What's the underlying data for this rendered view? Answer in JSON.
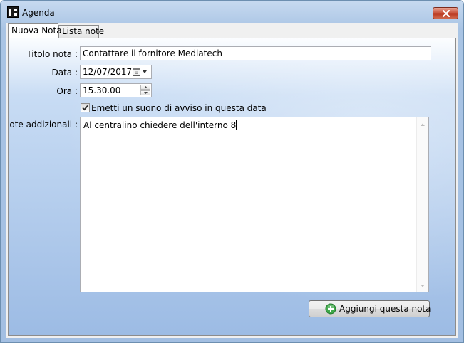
{
  "window": {
    "title": "Agenda",
    "close_icon": "close-icon"
  },
  "tabs": [
    {
      "label": "Nuova Nota",
      "active": true
    },
    {
      "label": "Lista note",
      "active": false
    }
  ],
  "form": {
    "title_label": "Titolo nota :",
    "title_value": "Contattare il fornitore Mediatech",
    "date_label": "Data :",
    "date_value": "12/07/2017",
    "time_label": "Ora :",
    "time_value": "15.30.00",
    "sound_checkbox_label": "Emetti un suono di avviso in questa data",
    "sound_checked": true,
    "notes_label": "Note addizionali :",
    "notes_value": "Al centralino chiedere dell'interno 8"
  },
  "actions": {
    "add_label": "Aggiungi questa nota"
  },
  "colors": {
    "accent_green": "#3fa84a",
    "close_red": "#c75138"
  }
}
